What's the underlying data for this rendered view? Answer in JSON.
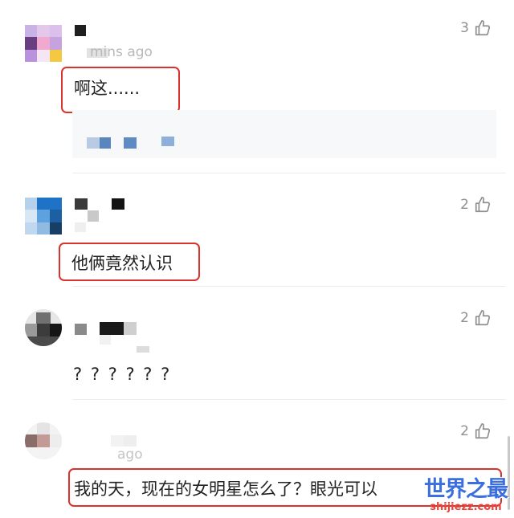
{
  "comments": [
    {
      "time": "mins ago",
      "likes": "3",
      "text": "啊这......"
    },
    {
      "time": "",
      "likes": "2",
      "text": "他俩竟然认识"
    },
    {
      "time": "",
      "likes": "2",
      "text": "? ? ? ? ? ?"
    },
    {
      "time": "ago",
      "likes": "2",
      "text": "我的天，现在的女明星怎么了？眼光可以"
    }
  ],
  "watermark": {
    "title": "世界之最",
    "url": "shijiezz.com"
  },
  "colors": {
    "highlight": "#d9332b",
    "watermark_blue": "#3b6fe0",
    "watermark_red": "#e8453c"
  },
  "icons": {
    "like": "thumbs-up-icon"
  }
}
